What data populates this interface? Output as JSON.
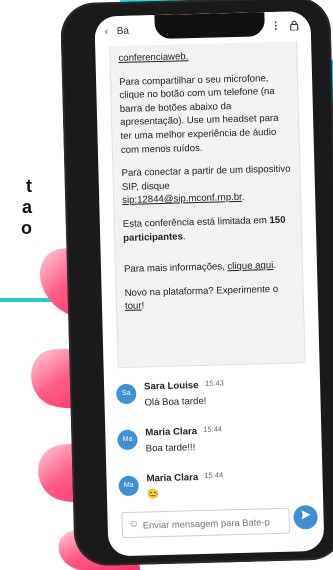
{
  "side_text": [
    "t",
    "a",
    "o"
  ],
  "topbar": {
    "back_icon": "chevron-left-icon",
    "title": "Ba",
    "more": "⋮",
    "lock_icon": "lock-icon"
  },
  "info": {
    "line_top": "conferenciaweb.",
    "p1": "Para compartilhar o seu microfone, clique no botão com um telefone (na barra de botões abaixo da apresentação). Use um headset para ter uma melhor experiência de áudio com menos ruídos.",
    "p2_a": "Para conectar a partir de um dispositivo SIP, disque",
    "p2_sip": "sip:12844@sip.mconf.rnp.br",
    "p2_end": ".",
    "p3_a": "Esta conferência está limitada em",
    "p3_b": "150 participantes",
    "p3_end": ".",
    "p4_a": "Para mais informações, ",
    "p4_link": "clique aqui",
    "p4_end": ".",
    "p5_a": "Novo na plataforma? Experimente o ",
    "p5_link": "tour",
    "p5_end": "!"
  },
  "messages": [
    {
      "initials": "Sa",
      "name": "Sara Louise",
      "time": "15:43",
      "text": "Olá Boa tarde!"
    },
    {
      "initials": "Ma",
      "name": "Maria Clara",
      "time": "15:44",
      "text": "Boa tarde!!!"
    },
    {
      "initials": "Ma",
      "name": "Maria Clara",
      "time": "15:44",
      "text": "😊"
    }
  ],
  "composer": {
    "placeholder": "Enviar mensagem para Bate-p",
    "emoji_icon": "smile-icon"
  },
  "send_icon": "send-icon",
  "colors": {
    "accent": "#3d8fd6",
    "cyan": "#29d3d6",
    "hand": "#ff4b73"
  }
}
